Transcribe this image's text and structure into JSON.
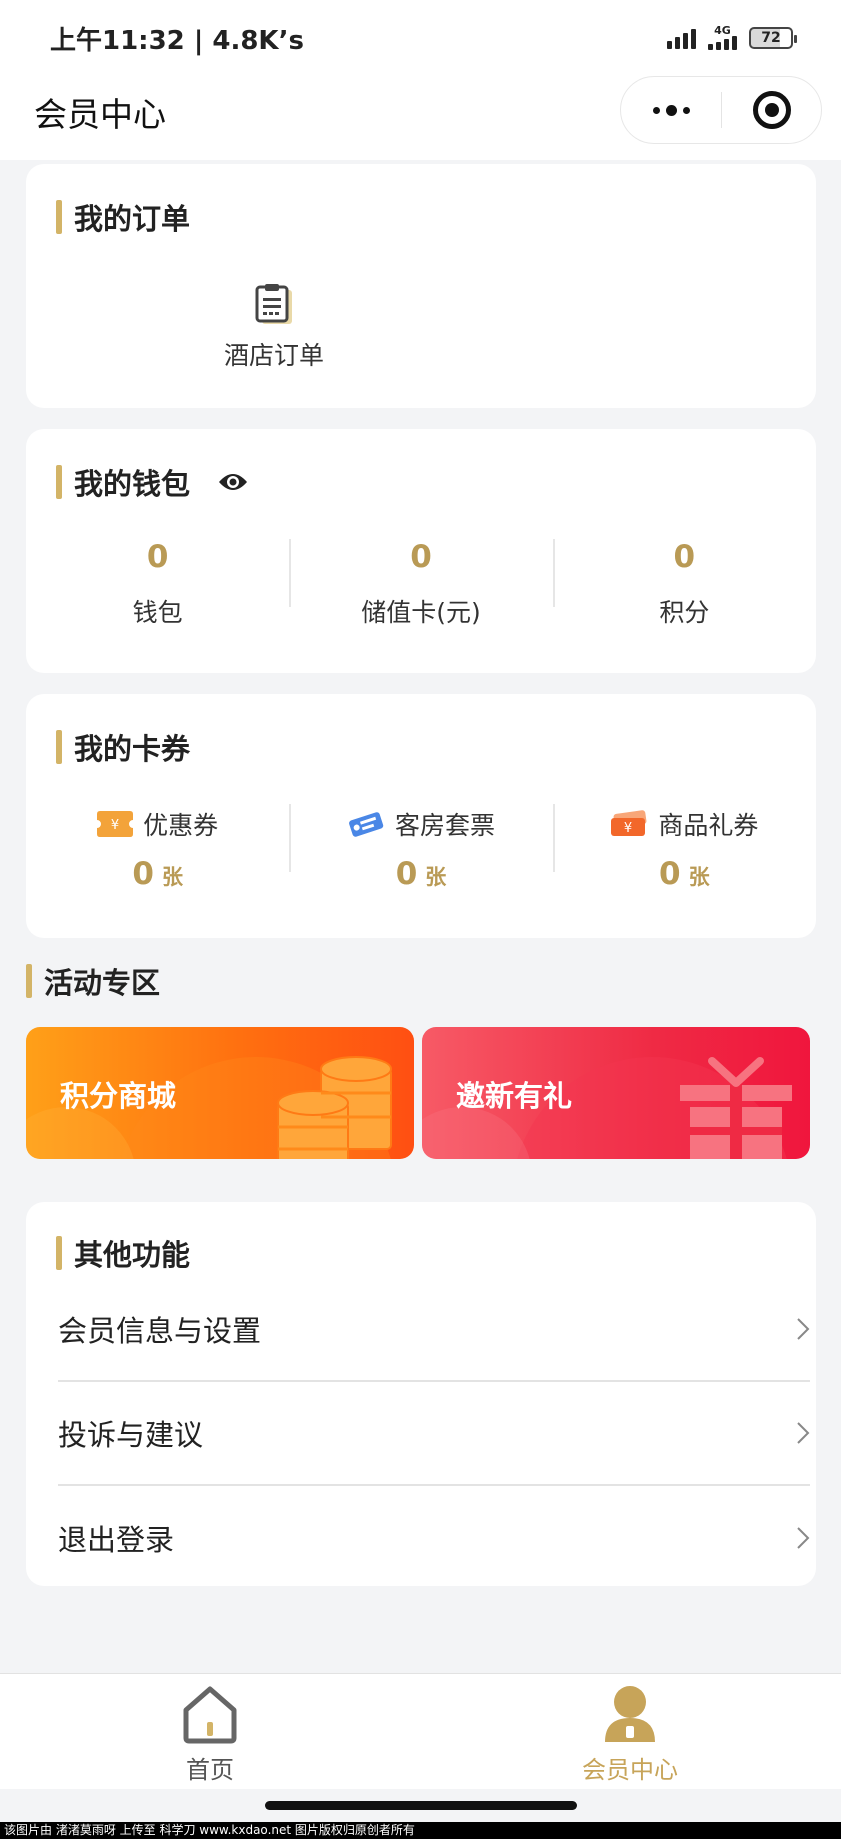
{
  "status_bar": {
    "time_text": "上午11:32 | 4.8K’s",
    "network": "4G",
    "battery": "72"
  },
  "nav": {
    "title": "会员中心"
  },
  "orders": {
    "title": "我的订单",
    "items": [
      {
        "label": "酒店订单",
        "icon": "clipboard-icon"
      }
    ]
  },
  "wallet": {
    "title": "我的钱包",
    "items": [
      {
        "value": "0",
        "label": "钱包"
      },
      {
        "value": "0",
        "label": "储值卡(元)"
      },
      {
        "value": "0",
        "label": "积分"
      }
    ]
  },
  "coupons": {
    "title": "我的卡券",
    "items": [
      {
        "label": "优惠券",
        "count": "0",
        "unit": "张",
        "icon": "coupon-icon",
        "color": "#f3a33a"
      },
      {
        "label": "客房套票",
        "count": "0",
        "unit": "张",
        "icon": "ticket-icon",
        "color": "#4a87e6"
      },
      {
        "label": "商品礼券",
        "count": "0",
        "unit": "张",
        "icon": "gift-voucher-icon",
        "color": "#f2672a"
      }
    ]
  },
  "activity": {
    "title": "活动专区",
    "banners": [
      {
        "label": "积分商城",
        "icon": "coins-icon"
      },
      {
        "label": "邀新有礼",
        "icon": "gift-icon"
      }
    ]
  },
  "other": {
    "title": "其他功能",
    "items": [
      {
        "label": "会员信息与设置"
      },
      {
        "label": "投诉与建议"
      },
      {
        "label": "退出登录"
      }
    ]
  },
  "tabbar": {
    "tabs": [
      {
        "label": "首页",
        "icon": "home-icon",
        "active": false
      },
      {
        "label": "会员中心",
        "icon": "member-icon",
        "active": true
      }
    ]
  },
  "watermark": {
    "text": "该图片由 渚渚莫雨呀 上传至 科学刀 www.kxdao.net 图片版权归原创者所有"
  },
  "colors": {
    "accent_gold": "#d3b467",
    "value_gold": "#b99a55",
    "background": "#f3f4f6"
  }
}
